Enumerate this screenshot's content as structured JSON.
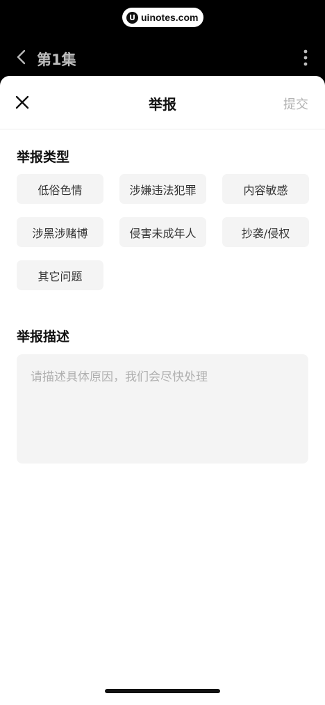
{
  "watermark": {
    "logo": "U",
    "text": "uinotes.com"
  },
  "background_page": {
    "title": "第1集"
  },
  "sheet": {
    "title": "举报",
    "submit_label": "提交",
    "report_type_title": "举报类型",
    "report_types": [
      "低俗色情",
      "涉嫌违法犯罪",
      "内容敏感",
      "涉黑涉赌博",
      "侵害未成年人",
      "抄袭/侵权",
      "其它问题"
    ],
    "description_title": "举报描述",
    "description_placeholder": "请描述具体原因，我们会尽快处理",
    "description_value": ""
  },
  "colors": {
    "background_dark": "#000000",
    "sheet_bg": "#ffffff",
    "chip_bg": "#f4f4f4",
    "submit_disabled": "#b3b3b3"
  }
}
